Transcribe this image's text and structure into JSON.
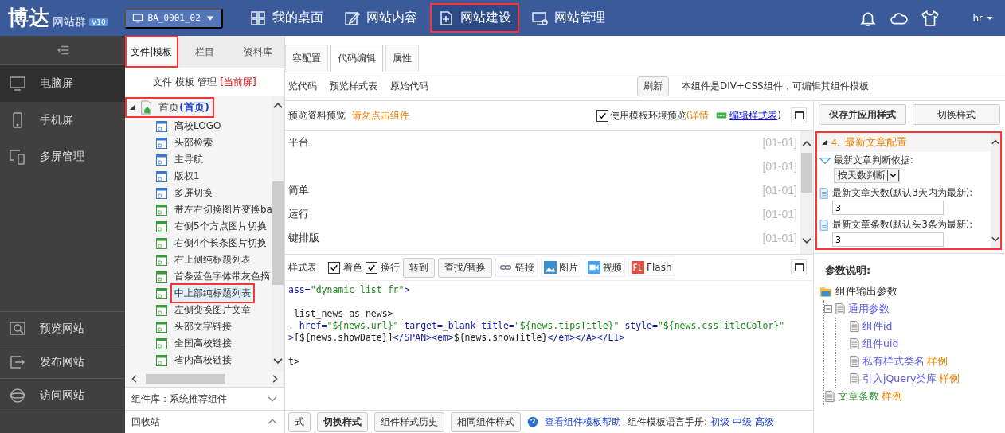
{
  "topbar": {
    "logo": "博达",
    "product": "网站群",
    "version": "V10",
    "site": "BA_0001_02",
    "nav": [
      {
        "label": "我的桌面",
        "highlighted": false
      },
      {
        "label": "网站内容",
        "highlighted": false
      },
      {
        "label": "网站建设",
        "highlighted": true
      },
      {
        "label": "网站管理",
        "highlighted": false
      }
    ],
    "user": "hr"
  },
  "sidebar": {
    "items": [
      {
        "label": "电脑屏",
        "selected": true
      },
      {
        "label": "手机屏",
        "selected": false
      },
      {
        "label": "多屏管理",
        "selected": false
      }
    ],
    "bottom_items": [
      "预览网站",
      "发布网站",
      "访问网站"
    ]
  },
  "tree_panel": {
    "tabs": [
      {
        "label": "文件|模板",
        "selected": true,
        "highlighted": true
      },
      {
        "label": "栏目",
        "selected": false,
        "highlighted": false
      },
      {
        "label": "资料库",
        "selected": false,
        "highlighted": false
      }
    ],
    "header": "文件|模板 管理",
    "header_note": "[当前屏]",
    "root": {
      "label": "首页",
      "note": "(首页)",
      "expanded": true,
      "highlighted": true,
      "children": [
        {
          "label": "高校LOGO",
          "kind": "blue",
          "selected": false
        },
        {
          "label": "头部检索",
          "kind": "blue",
          "selected": false
        },
        {
          "label": "主导航",
          "kind": "blue",
          "selected": false
        },
        {
          "label": "版权1",
          "kind": "blue",
          "selected": false
        },
        {
          "label": "多屏切换",
          "kind": "blue",
          "selected": false
        },
        {
          "label": "带左右切换图片变换ba",
          "kind": "green",
          "selected": false
        },
        {
          "label": "右侧5个方点图片切换",
          "kind": "green",
          "selected": false
        },
        {
          "label": "右侧4个长条图片切换",
          "kind": "green",
          "selected": false
        },
        {
          "label": "右上侧纯标题列表",
          "kind": "green",
          "selected": false
        },
        {
          "label": "首条蓝色字体带灰色摘",
          "kind": "green",
          "selected": false
        },
        {
          "label": "中上部纯标题列表",
          "kind": "green",
          "selected": true
        },
        {
          "label": "左侧变换图片文章",
          "kind": "green",
          "selected": false
        },
        {
          "label": "头部文字链接",
          "kind": "green",
          "selected": false
        },
        {
          "label": "全国高校链接",
          "kind": "green",
          "selected": false
        },
        {
          "label": "省内高校链接",
          "kind": "green",
          "selected": false
        }
      ]
    },
    "library": "组件库：系统推荐组件",
    "recycle": "回收站"
  },
  "editor": {
    "tabs": [
      {
        "label": "容配置",
        "selected": false
      },
      {
        "label": "代码编辑",
        "selected": true
      },
      {
        "label": "属性",
        "selected": false
      }
    ],
    "views": [
      "览代码",
      "预览样式表",
      "原始代码"
    ],
    "refresh": "刷新",
    "info": "本组件是DIV+CSS组件，可编辑其组件模板",
    "preview_label": "预览资料预览",
    "warning": "请勿点击组件",
    "use_env": {
      "label": "使用模板环境预览",
      "checked": true
    },
    "details": "(详情",
    "edit_css": "编辑样式表",
    "close_paren": ")",
    "preview_rows": [
      {
        "title": "平台",
        "date": "[01-01]"
      },
      {
        "date": "[01-01]"
      },
      {
        "title": "简单",
        "date": "[01-01]"
      },
      {
        "title": "运行",
        "date": "[01-01]"
      },
      {
        "title": "键排版",
        "date": "[01-01]"
      }
    ],
    "code_toolbar": {
      "label": "样式表",
      "toggles": [
        {
          "label": "着色",
          "checked": true
        },
        {
          "label": "换行",
          "checked": true
        }
      ],
      "buttons": [
        "转到",
        "查找/替换"
      ],
      "inserts": [
        "链接",
        "图片",
        "视频",
        "Flash"
      ]
    },
    "code_lines": [
      {
        "spaced": false,
        "segments": [
          {
            "text": "ass=",
            "kind": "tag"
          },
          {
            "text": "\"dynamic_list fr\"",
            "kind": "string"
          },
          {
            "text": ">",
            "kind": "tag"
          }
        ]
      },
      {
        "spaced": true,
        "segments": [
          {
            "text": " list_news as news>",
            "kind": "text"
          }
        ]
      },
      {
        "spaced": false,
        "segments": [
          {
            "text": ". href=",
            "kind": "tag"
          },
          {
            "text": "\"${news.url}\"",
            "kind": "string"
          },
          {
            "text": " target=_blank title=",
            "kind": "tag"
          },
          {
            "text": "\"${news.tipsTitle}\"",
            "kind": "string"
          },
          {
            "text": " style=",
            "kind": "tag"
          },
          {
            "text": "\"${news.cssTitleColor}\"",
            "kind": "string"
          }
        ]
      },
      {
        "spaced": false,
        "segments": [
          {
            "text": ">",
            "kind": "tag"
          },
          {
            "text": "[${news.showDate}]",
            "kind": "text"
          },
          {
            "text": "</SPAN><em>",
            "kind": "tag"
          },
          {
            "text": "${news.showTitle}",
            "kind": "text"
          },
          {
            "text": "</em></A></LI>",
            "kind": "tag"
          }
        ]
      },
      {
        "spaced": true,
        "segments": [
          {
            "text": "t>",
            "kind": "text"
          }
        ]
      }
    ],
    "bottom_buttons": [
      "式",
      "切换样式",
      "组件样式历史",
      "相同组件样式"
    ],
    "help_link": "查看组件模板帮助",
    "manual": "组件模板语言手册:",
    "manual_links": [
      "初级",
      "中级",
      "高级"
    ]
  },
  "style_panel": {
    "buttons": [
      "保存并应用样式",
      "切换样式"
    ],
    "section": {
      "number": "4.",
      "title": "最新文章配置",
      "expanded": true,
      "highlighted": true,
      "fields": [
        {
          "kind": "select",
          "label": "最新文章判断依据:",
          "value": "按天数判断"
        },
        {
          "kind": "text",
          "label": "最新文章天数(默认3天内为最新):",
          "value": "3"
        },
        {
          "kind": "text",
          "label": "最新文章条数(默认头3条为最新):",
          "value": "3"
        }
      ]
    },
    "params_title": "参数说明:",
    "params": {
      "label": "组件输出参数",
      "children": [
        {
          "label": "通用参数",
          "expanded": true,
          "color": "#5a5ae6",
          "children": [
            {
              "label": "组件id",
              "color": "#5a5ae6"
            },
            {
              "label": "组件uid",
              "color": "#5a5ae6"
            },
            {
              "label": "私有样式类名",
              "sample": "样例",
              "color": "#5a5ae6"
            },
            {
              "label": "引入jQuery类库",
              "sample": "样例",
              "color": "#5a5ae6"
            }
          ]
        },
        {
          "label": "文章条数",
          "sample": "样例",
          "color": "#3c9a3c"
        }
      ]
    }
  }
}
